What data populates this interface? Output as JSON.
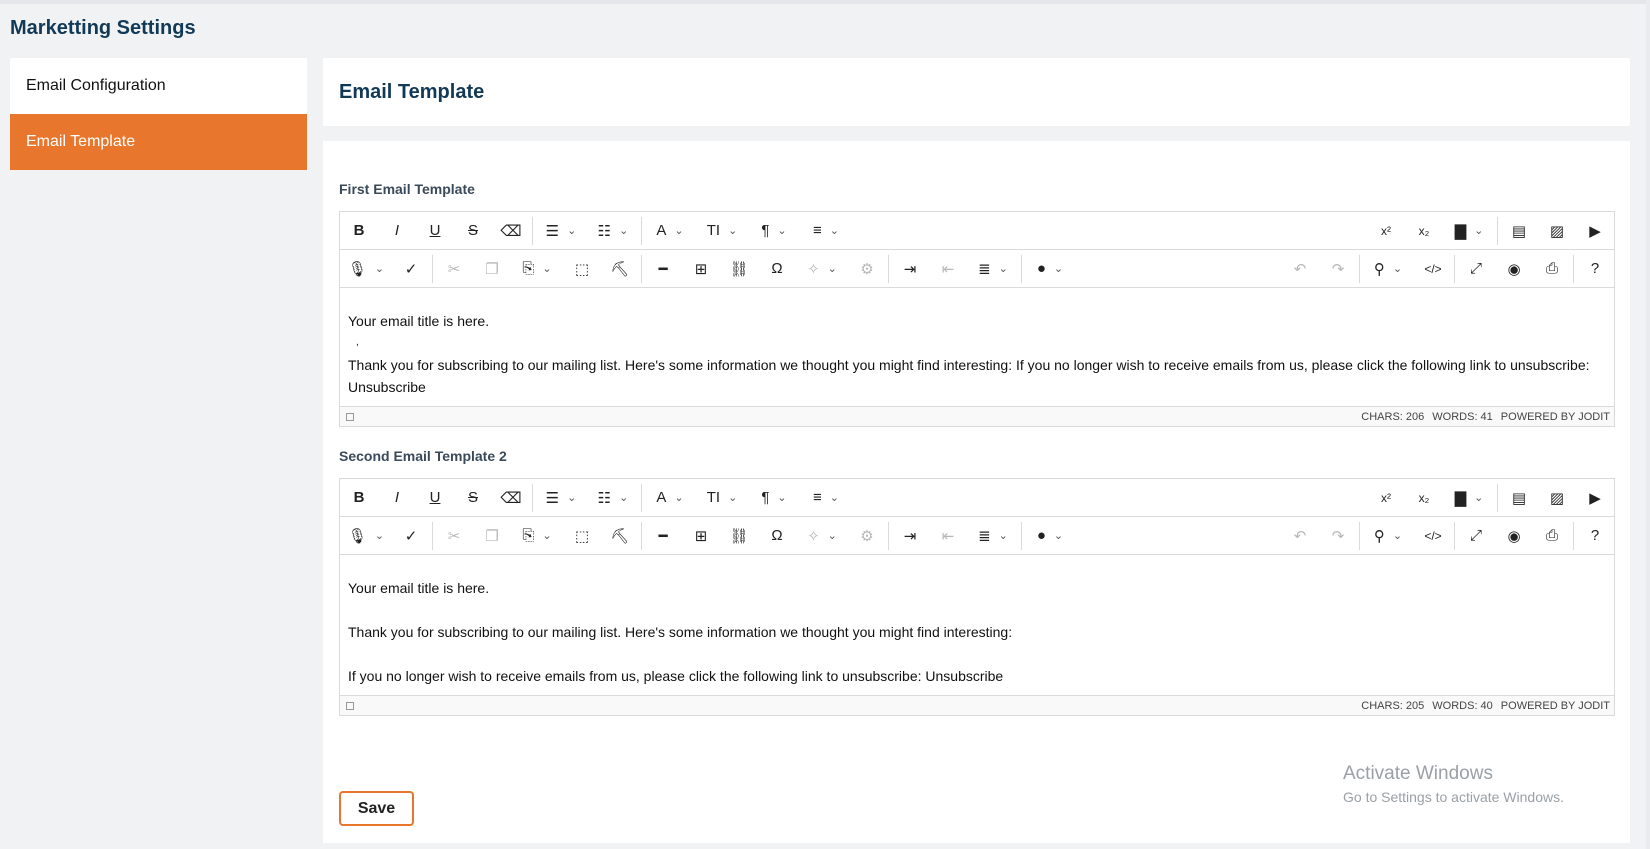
{
  "page": {
    "title": "Marketting Settings"
  },
  "sidebar": {
    "items": [
      {
        "label": "Email Configuration",
        "active": false
      },
      {
        "label": "Email Template",
        "active": true
      }
    ]
  },
  "header": {
    "title": "Email Template"
  },
  "colors": {
    "accent": "#e8762c",
    "heading": "#123a57"
  },
  "editors": [
    {
      "label": "First Email Template",
      "content": [
        "Your email title is here.",
        ",",
        "Thank you for subscribing to our mailing list. Here's some information we thought you might find interesting:  If you no longer wish to receive emails from us, please click the following link to unsubscribe: Unsubscribe"
      ],
      "chars": "CHARS: 206",
      "words": "WORDS: 41",
      "powered": "POWERED BY JODIT"
    },
    {
      "label": "Second Email Template 2",
      "content": [
        "Your email title is here.",
        "",
        "Thank you for subscribing to our mailing list. Here's some information we thought you might find interesting:",
        "",
        "If you no longer wish to receive emails from us, please click the following link to unsubscribe: Unsubscribe"
      ],
      "chars": "CHARS: 205",
      "words": "WORDS: 40",
      "powered": "POWERED BY JODIT"
    }
  ],
  "toolbar_glyphs": {
    "bold": "B",
    "italic": "I",
    "underline": "U",
    "strike": "S",
    "eraser": "⌫",
    "ul": "☰",
    "ol": "☷",
    "font": "A",
    "fontsize": "TI",
    "paragraph": "¶",
    "lineheight": "≡",
    "superscript": "x²",
    "subscript": "x₂",
    "file": "▇",
    "doc": "▤",
    "image": "▨",
    "video": "▶",
    "mic": "🎙",
    "spell": "✓",
    "cut": "✂",
    "copy": "❐",
    "paste": "⎘",
    "selectall": "⬚",
    "brush": "⛏",
    "hr": "━",
    "table": "⊞",
    "link": "⛓",
    "omega": "Ω",
    "magic": "✧",
    "robot": "⚙",
    "indent": "⇥",
    "outdent": "⇤",
    "align": "≣",
    "color": "●",
    "undo": "↶",
    "redo": "↷",
    "search": "⚲",
    "source": "</>",
    "fullsize": "⤢",
    "preview": "◉",
    "print": "⎙",
    "help": "?"
  },
  "save": {
    "label": "Save"
  },
  "watermark": {
    "line1": "Activate Windows",
    "line2": "Go to Settings to activate Windows."
  }
}
